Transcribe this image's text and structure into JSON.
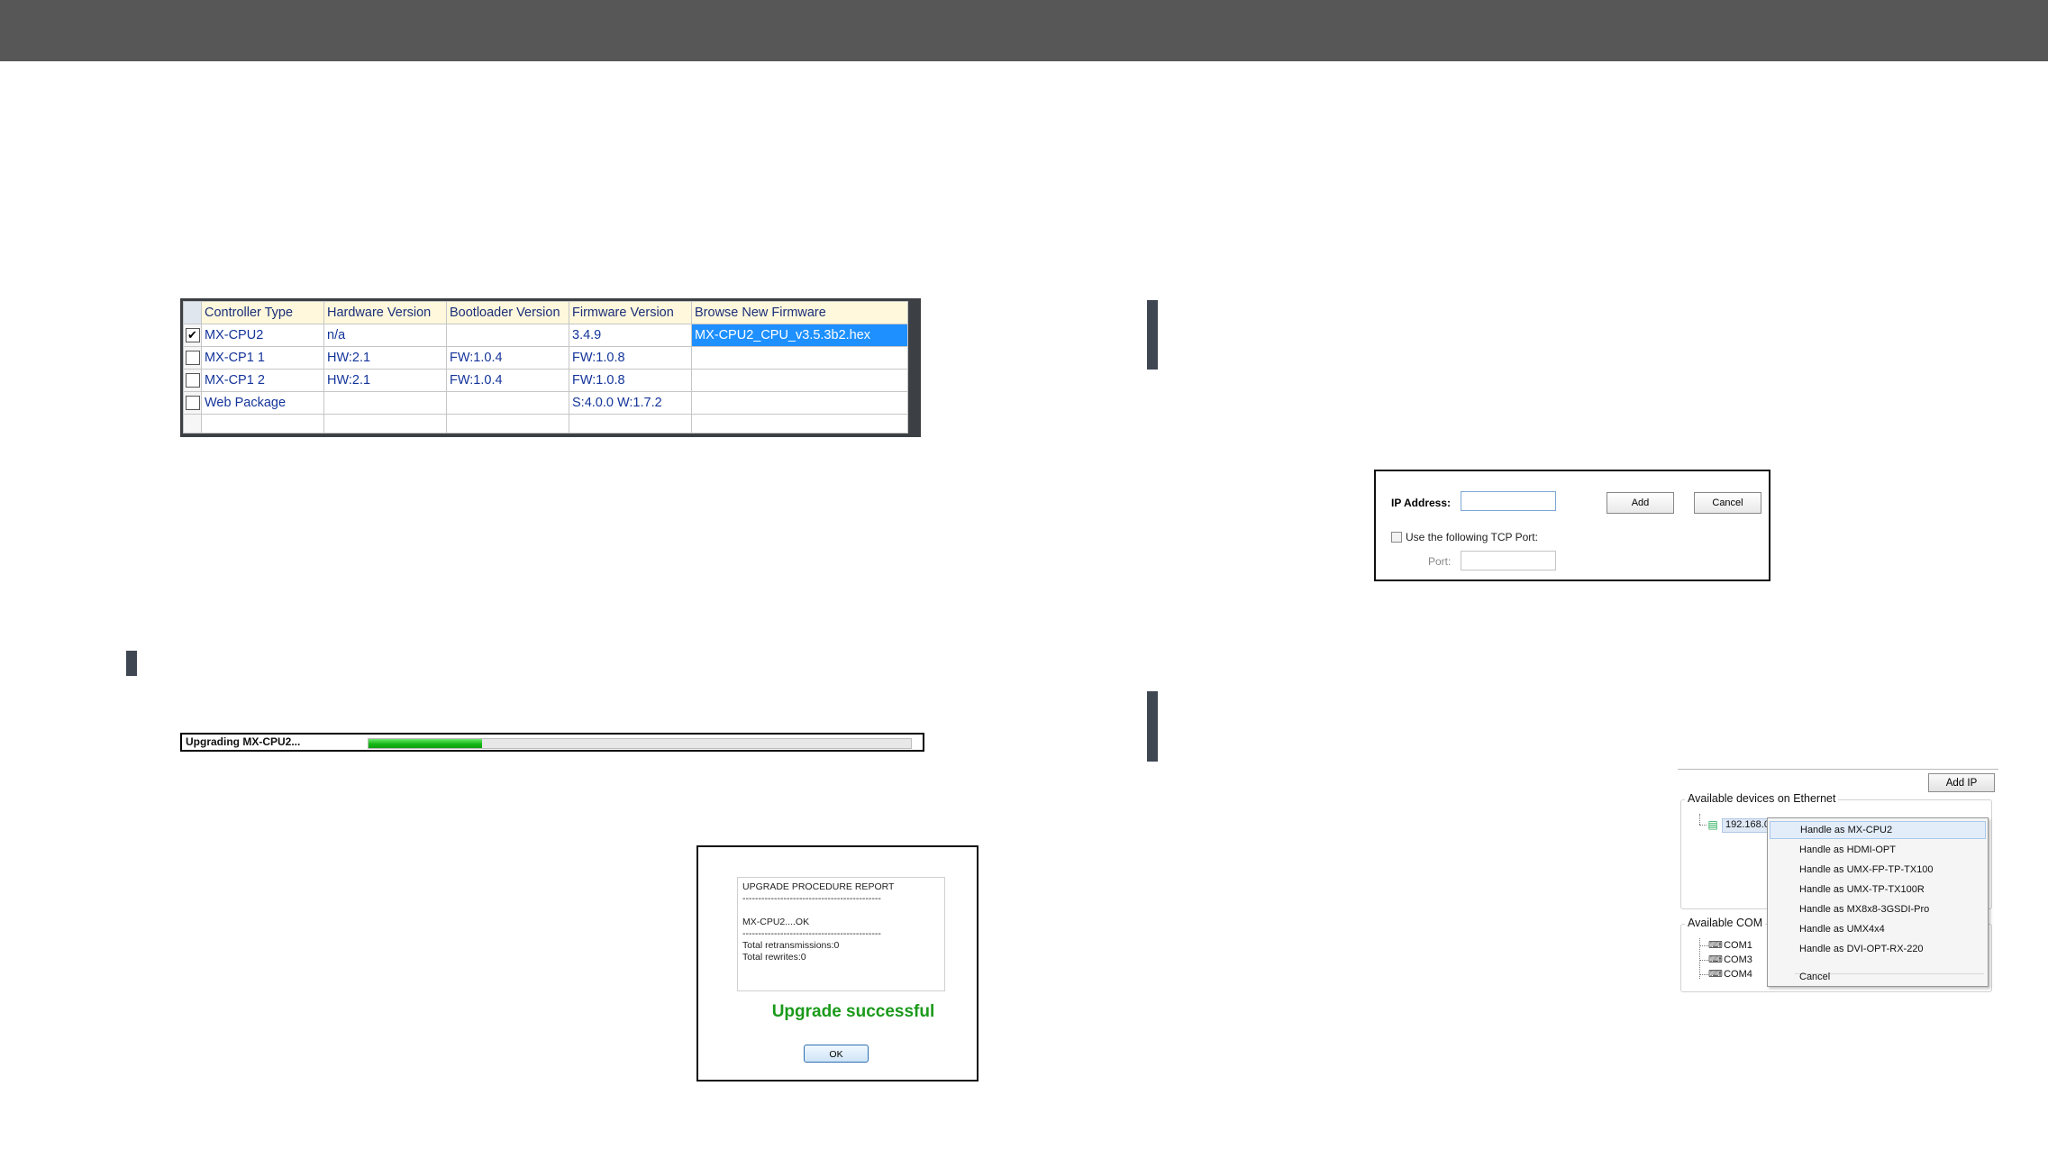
{
  "firmware_table": {
    "headers": [
      "Controller Type",
      "Hardware Version",
      "Bootloader Version",
      "Firmware Version",
      "Browse New Firmware"
    ],
    "rows": [
      {
        "checked": true,
        "controller": "MX-CPU2",
        "hardware": "n/a",
        "bootloader": "",
        "firmware": "3.4.9",
        "browse": "MX-CPU2_CPU_v3.5.3b2.hex"
      },
      {
        "checked": false,
        "controller": "MX-CP1 1",
        "hardware": "HW:2.1",
        "bootloader": "FW:1.0.4",
        "firmware": "FW:1.0.8",
        "browse": ""
      },
      {
        "checked": false,
        "controller": "MX-CP1 2",
        "hardware": "HW:2.1",
        "bootloader": "FW:1.0.4",
        "firmware": "FW:1.0.8",
        "browse": ""
      },
      {
        "checked": false,
        "controller": "Web Package",
        "hardware": "",
        "bootloader": "",
        "firmware": "S:4.0.0 W:1.7.2",
        "browse": ""
      }
    ],
    "check_mark": "✔",
    "selected_color": "#1e90ff"
  },
  "progress": {
    "label": "Upgrading MX-CPU2...",
    "fraction": 0.21,
    "color": "#16b816"
  },
  "report": {
    "lines": [
      "UPGRADE PROCEDURE REPORT",
      "--------------------------------------------",
      "",
      "MX-CPU2....OK",
      "--------------------------------------------",
      "Total retransmissions:0",
      "Total rewrites:0"
    ],
    "status": "Upgrade successful",
    "status_color": "#1b9a1b",
    "ok_label": "OK"
  },
  "ip_dialog": {
    "ip_label": "IP Address:",
    "ip_value": "",
    "add_label": "Add",
    "cancel_label": "Cancel",
    "tcp_checkbox_label": "Use the following TCP Port:",
    "tcp_checked": false,
    "port_label": "Port:",
    "port_value": ""
  },
  "device_panel": {
    "add_ip_label": "Add IP",
    "ethernet_title": "Available devices on Ethernet",
    "ethernet_device": "192.168.0",
    "com_title": "Available COM",
    "com_ports": [
      "COM1",
      "COM3",
      "COM4"
    ],
    "context_menu": [
      "Handle as MX-CPU2",
      "Handle as HDMI-OPT",
      "Handle as UMX-FP-TP-TX100",
      "Handle as UMX-TP-TX100R",
      "Handle as MX8x8-3GSDI-Pro",
      "Handle as UMX4x4",
      "Handle as DVI-OPT-RX-220"
    ],
    "context_cancel": "Cancel"
  }
}
